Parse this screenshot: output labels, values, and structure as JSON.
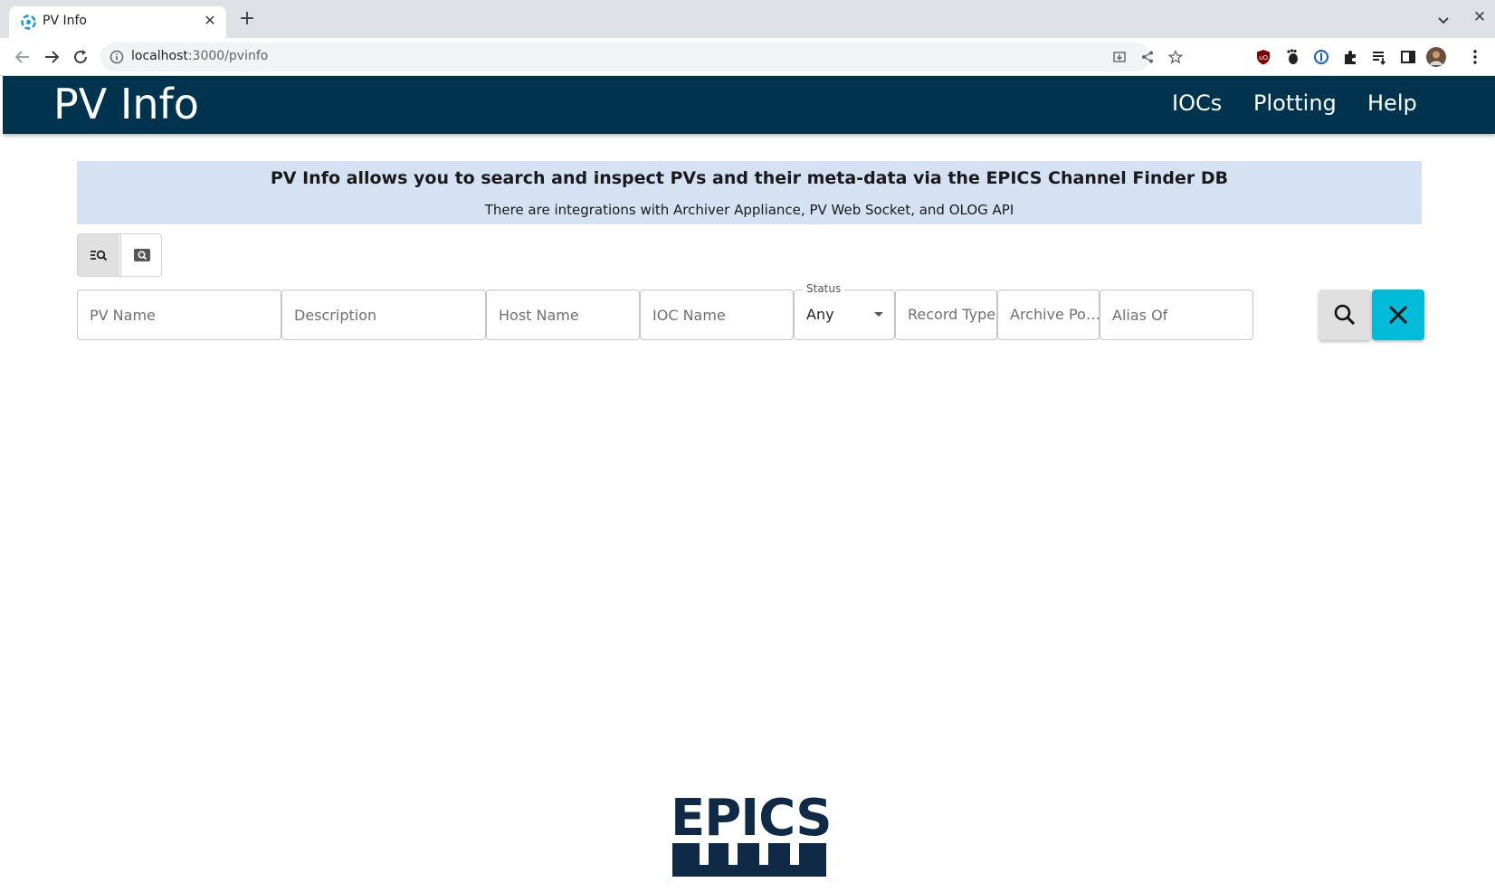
{
  "browser": {
    "tab_title": "PV Info",
    "url_host": "localhost",
    "url_path": ":3000/pvinfo"
  },
  "app": {
    "brand": "PV Info",
    "nav": {
      "iocs": "IOCs",
      "plotting": "Plotting",
      "help": "Help"
    },
    "header_color": "#00334d"
  },
  "banner": {
    "title": "PV Info allows you to search and inspect PVs and their meta-data via the EPICS Channel Finder DB",
    "subtitle": "There are integrations with Archiver Appliance, PV Web Socket, and OLOG API",
    "background": "#d5e2f3"
  },
  "search": {
    "pv_name_placeholder": "PV Name",
    "description_placeholder": "Description",
    "host_name_placeholder": "Host Name",
    "ioc_name_placeholder": "IOC Name",
    "status_label": "Status",
    "status_value": "Any",
    "record_type_placeholder": "Record Type",
    "archive_policy_placeholder": "Archive Po…",
    "alias_of_placeholder": "Alias Of",
    "clear_button_color": "#00bcd9"
  },
  "footer": {
    "logo_text": "EPICS"
  }
}
